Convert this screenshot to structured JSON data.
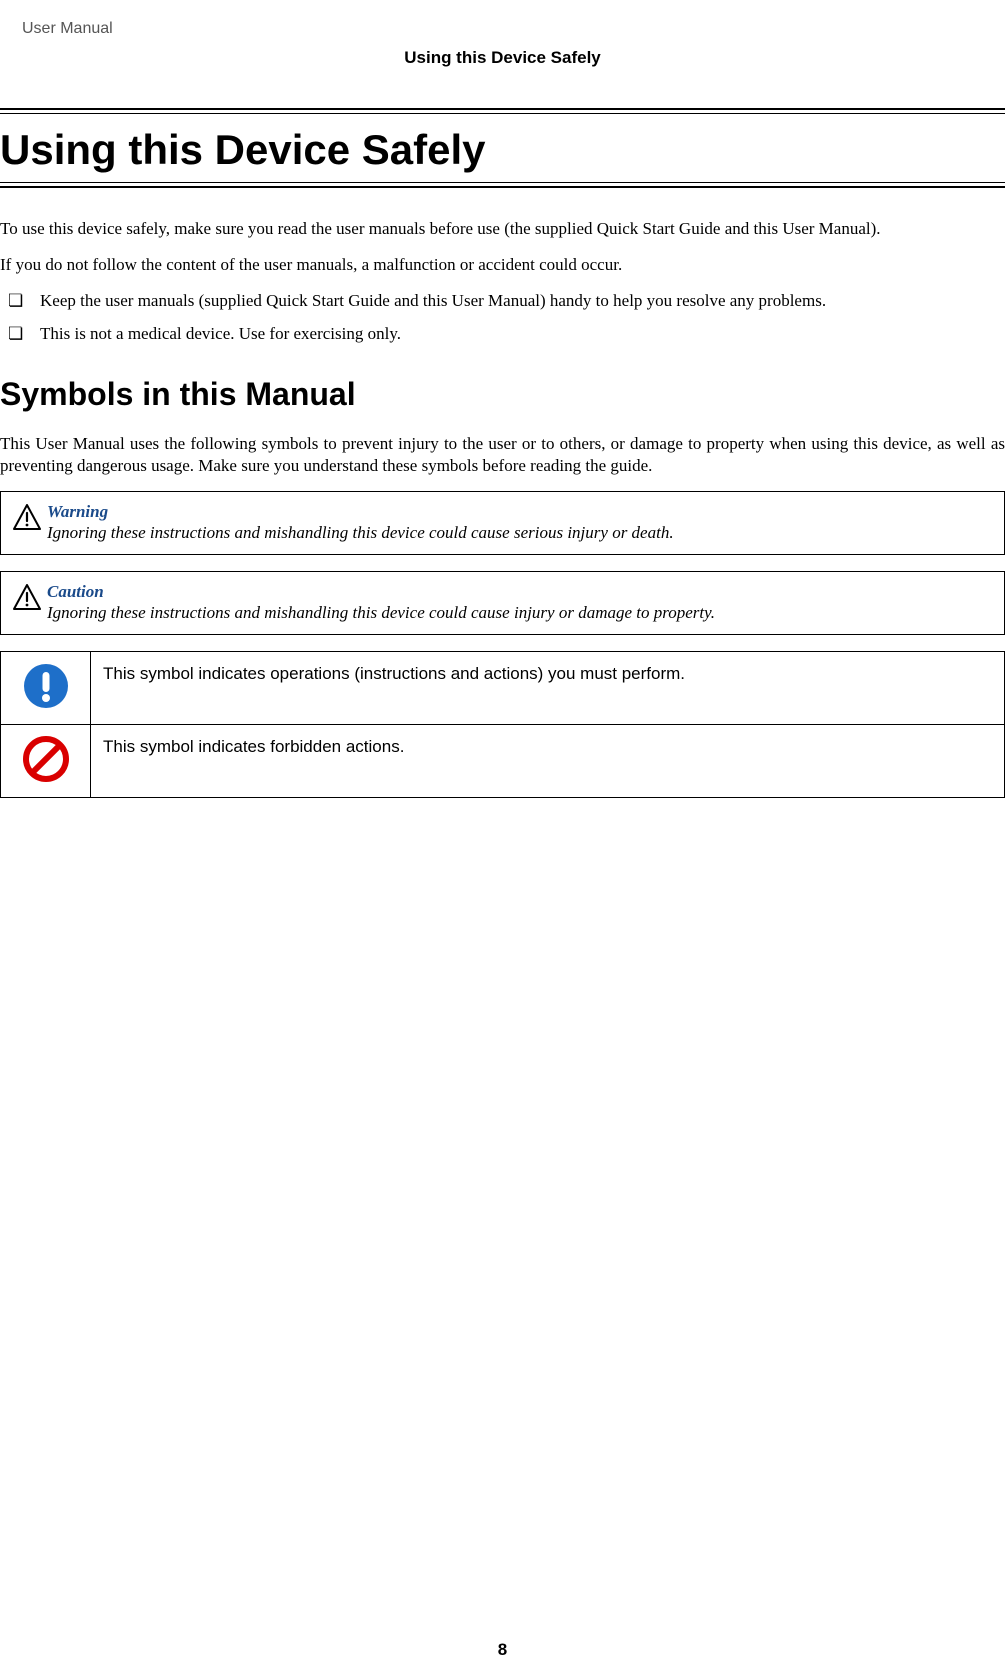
{
  "header": {
    "doc_label": "User Manual",
    "section_header": "Using this Device Safely"
  },
  "title": "Using this Device Safely",
  "intro": {
    "p1": "To use this device safely, make sure you read the user manuals before use (the supplied Quick Start Guide and this User Manual).",
    "p2": "If you do not follow the content of the user manuals, a malfunction or accident could occur."
  },
  "bullets": [
    "Keep the user manuals (supplied Quick Start Guide and this User Manual) handy to help you resolve any problems.",
    "This is not a medical device. Use for exercising only."
  ],
  "subheading": "Symbols in this Manual",
  "symbols_intro": "This User Manual uses the following symbols to prevent injury to the user or to others, or damage to property when using this device, as well as preventing dangerous usage. Make sure you understand these symbols before reading the guide.",
  "warning": {
    "label": "Warning",
    "text": "Ignoring these instructions and mishandling this device could cause serious injury or death."
  },
  "caution": {
    "label": "Caution",
    "text": "Ignoring these instructions and mishandling this device could cause injury or damage to property."
  },
  "symbol_rows": [
    {
      "icon": "must-do",
      "text": "This symbol indicates operations (instructions and actions) you must perform."
    },
    {
      "icon": "forbidden",
      "text": "This symbol indicates forbidden actions."
    }
  ],
  "page_number": "8"
}
